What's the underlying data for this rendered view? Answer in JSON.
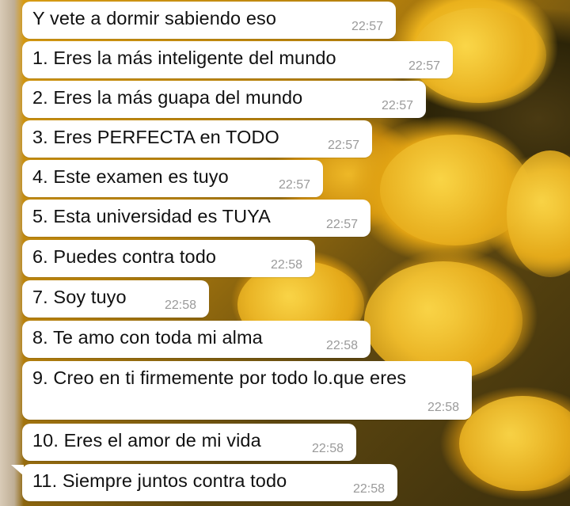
{
  "messages": [
    {
      "text": "Y vete a dormir sabiendo eso",
      "time": "22:57"
    },
    {
      "text": "1. Eres la más inteligente del mundo",
      "time": "22:57"
    },
    {
      "text": "2. Eres la más guapa del mundo",
      "time": "22:57"
    },
    {
      "text": "3. Eres PERFECTA en TODO",
      "time": "22:57"
    },
    {
      "text": "4. Este examen es tuyo",
      "time": "22:57"
    },
    {
      "text": "5. Esta universidad es TUYA",
      "time": "22:57"
    },
    {
      "text": "6. Puedes contra todo",
      "time": "22:58"
    },
    {
      "text": "7. Soy tuyo",
      "time": "22:58"
    },
    {
      "text": "8. Te amo con toda mi alma",
      "time": "22:58"
    },
    {
      "text": "9. Creo en ti firmemente por todo lo.que eres",
      "time": "22:58"
    },
    {
      "text": "10. Eres el amor de mi vida",
      "time": "22:58"
    },
    {
      "text": "11. Siempre juntos contra todo",
      "time": "22:58"
    }
  ],
  "background": {
    "theme": "yellow roses wallpaper",
    "bubble_color": "#ffffff",
    "time_color": "#9a9a9a"
  }
}
